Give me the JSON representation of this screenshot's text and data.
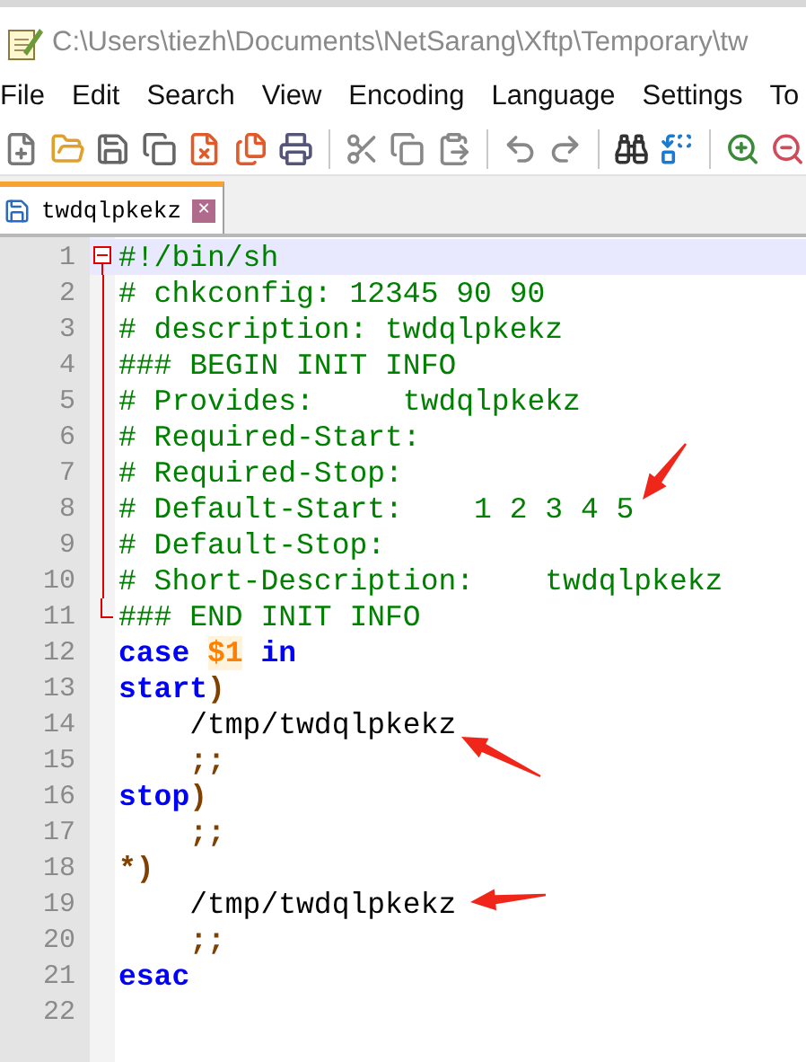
{
  "window": {
    "title": "C:\\Users\\tiezh\\Documents\\NetSarang\\Xftp\\Temporary\\tw"
  },
  "menu": [
    {
      "label": "File"
    },
    {
      "label": "Edit"
    },
    {
      "label": "Search"
    },
    {
      "label": "View"
    },
    {
      "label": "Encoding"
    },
    {
      "label": "Language"
    },
    {
      "label": "Settings"
    },
    {
      "label": "To"
    }
  ],
  "tabs": [
    {
      "label": "twdqlpkekz",
      "close": "✕",
      "selected": true
    }
  ],
  "editor": {
    "lines": [
      {
        "number": "1",
        "current": true,
        "expanded": true,
        "tokens": [
          {
            "kind": "comment",
            "text": "#!/bin/sh"
          }
        ],
        "children": [
          {
            "number": "2",
            "current": false,
            "tokens": [
              {
                "kind": "comment",
                "text": "# chkconfig: 12345 90 90"
              }
            ]
          },
          {
            "number": "3",
            "current": false,
            "tokens": [
              {
                "kind": "comment",
                "text": "# description: twdqlpkekz"
              }
            ]
          },
          {
            "number": "4",
            "current": false,
            "tokens": [
              {
                "kind": "comment",
                "text": "### BEGIN INIT INFO"
              }
            ]
          },
          {
            "number": "5",
            "current": false,
            "tokens": [
              {
                "kind": "comment",
                "text": "# Provides:     twdqlpkekz"
              }
            ]
          },
          {
            "number": "6",
            "current": false,
            "tokens": [
              {
                "kind": "comment",
                "text": "# Required-Start:"
              }
            ]
          },
          {
            "number": "7",
            "current": false,
            "tokens": [
              {
                "kind": "comment",
                "text": "# Required-Stop:"
              }
            ]
          },
          {
            "number": "8",
            "current": false,
            "annotation": {
              "kind": "downleft"
            },
            "tokens": [
              {
                "kind": "comment",
                "text": "# Default-Start:    1 2 3 4 5"
              }
            ]
          },
          {
            "number": "9",
            "current": false,
            "tokens": [
              {
                "kind": "comment",
                "text": "# Default-Stop:"
              }
            ]
          },
          {
            "number": "10",
            "current": false,
            "tokens": [
              {
                "kind": "comment",
                "text": "# Short-Description:    twdqlpkekz"
              }
            ]
          },
          {
            "number": "11",
            "current": false,
            "tokens": [
              {
                "kind": "comment",
                "text": "### END INIT INFO"
              }
            ]
          }
        ]
      },
      {
        "number": "12",
        "current": false,
        "tokens": [
          {
            "kind": "keyword",
            "text": "case "
          },
          {
            "kind": "variable",
            "text": "$1"
          },
          {
            "kind": "keyword",
            "text": " in"
          }
        ]
      },
      {
        "number": "13",
        "current": false,
        "tokens": [
          {
            "kind": "keyword",
            "text": "start"
          },
          {
            "kind": "operator",
            "text": ")"
          }
        ]
      },
      {
        "number": "14",
        "current": false,
        "annotation": {
          "kind": "upleft"
        },
        "tokens": [
          {
            "kind": "plain",
            "text": "    /tmp/twdqlpkekz"
          }
        ]
      },
      {
        "number": "15",
        "current": false,
        "tokens": [
          {
            "kind": "operator",
            "text": "    ;;"
          }
        ]
      },
      {
        "number": "16",
        "current": false,
        "tokens": [
          {
            "kind": "keyword",
            "text": "stop"
          },
          {
            "kind": "operator",
            "text": ")"
          }
        ]
      },
      {
        "number": "17",
        "current": false,
        "tokens": [
          {
            "kind": "operator",
            "text": "    ;;"
          }
        ]
      },
      {
        "number": "18",
        "current": false,
        "tokens": [
          {
            "kind": "operator",
            "text": "*)"
          }
        ]
      },
      {
        "number": "19",
        "current": false,
        "annotation": {
          "kind": "left"
        },
        "tokens": [
          {
            "kind": "plain",
            "text": "    /tmp/twdqlpkekz"
          }
        ]
      },
      {
        "number": "20",
        "current": false,
        "tokens": [
          {
            "kind": "operator",
            "text": "    ;;"
          }
        ]
      },
      {
        "number": "21",
        "current": false,
        "tokens": [
          {
            "kind": "keyword",
            "text": "esac"
          }
        ]
      },
      {
        "number": "22",
        "current": false
      }
    ]
  }
}
